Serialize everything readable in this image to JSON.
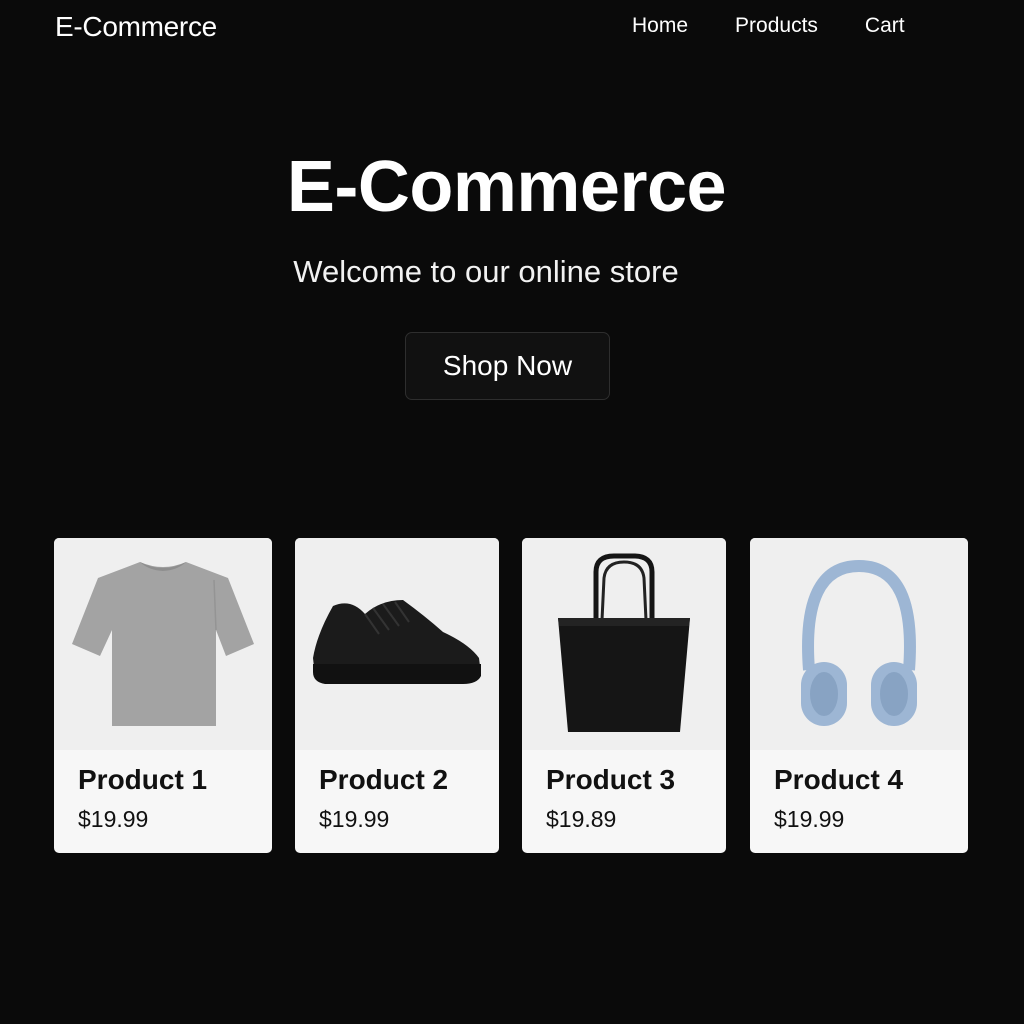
{
  "header": {
    "brand": "E-Commerce",
    "nav": [
      {
        "label": "Home"
      },
      {
        "label": "Products"
      },
      {
        "label": "Cart"
      }
    ]
  },
  "hero": {
    "title": "E-Commerce",
    "subtitle": "Welcome to our online store",
    "cta_label": "Shop Now"
  },
  "products": [
    {
      "name": "Product 1",
      "price": "$19.99",
      "image": "tshirt-icon",
      "color": "#a3a3a3"
    },
    {
      "name": "Product 2",
      "price": "$19.99",
      "image": "sneaker-icon",
      "color": "#1a1a1a"
    },
    {
      "name": "Product 3",
      "price": "$19.89",
      "image": "tote-bag-icon",
      "color": "#151515"
    },
    {
      "name": "Product 4",
      "price": "$19.99",
      "image": "headphones-icon",
      "color": "#9db6d4"
    }
  ],
  "colors": {
    "background": "#0a0a0a",
    "card_background": "#f7f7f7",
    "card_image_background": "#efefef",
    "text_light": "#ffffff",
    "text_dark": "#111111"
  }
}
